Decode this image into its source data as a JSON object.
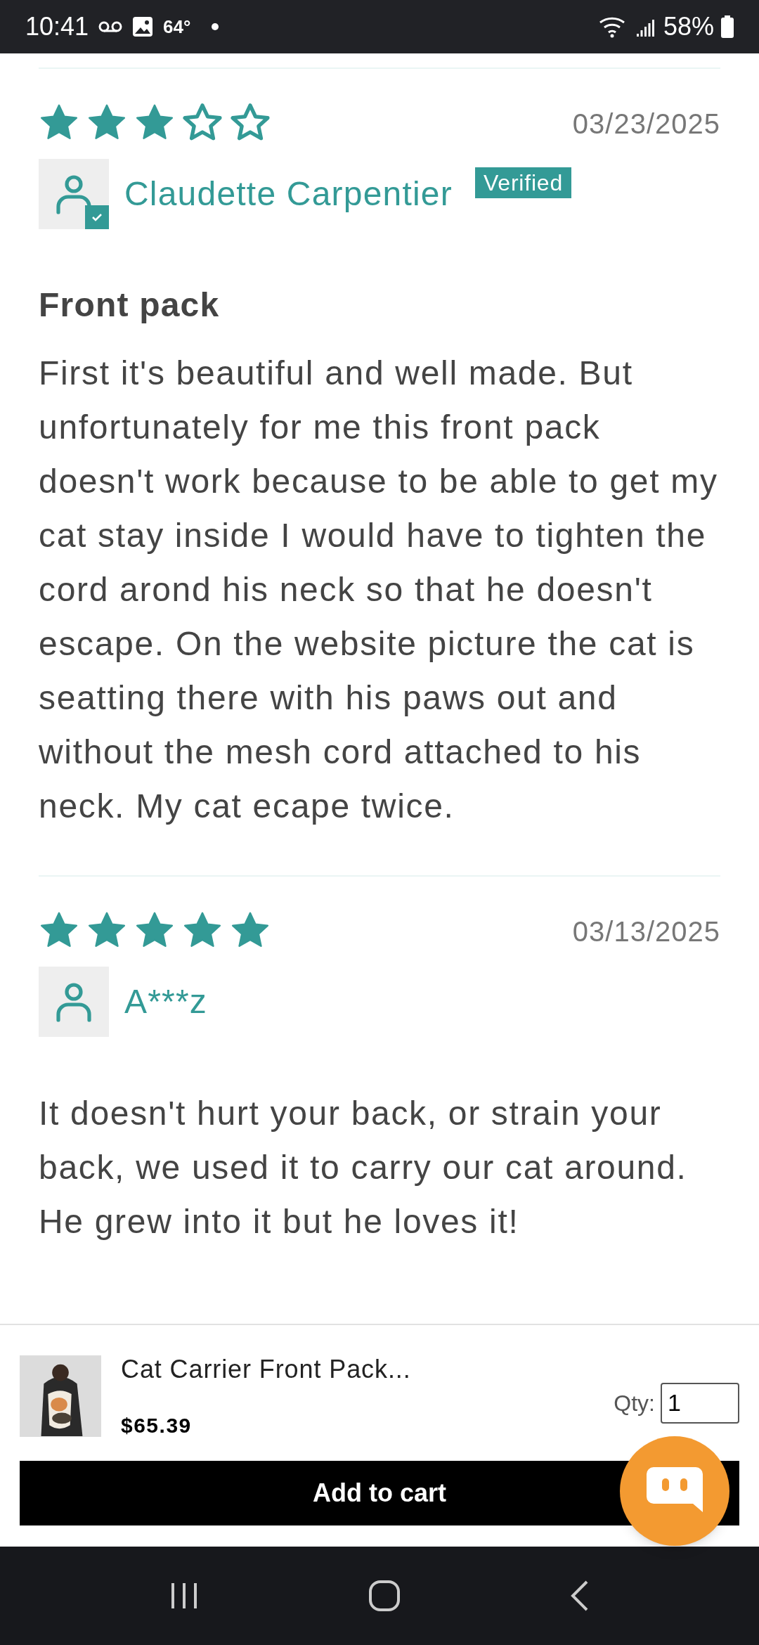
{
  "status_bar": {
    "time": "10:41",
    "temperature": "64°",
    "battery": "58%"
  },
  "reviews": [
    {
      "stars": 3,
      "date": "03/23/2025",
      "reviewer": "Claudette Carpentier",
      "verified": true,
      "badge": "Verified",
      "title": "Front pack",
      "body": "First it's beautiful and well made. But unfortunately for me this front pack doesn't work because to be able to get my cat stay inside I would have to tighten the cord arond his neck so that he doesn't escape. On the website picture the cat is seatting there with his paws out and without the mesh cord attached to his neck. My cat ecape twice."
    },
    {
      "stars": 5,
      "date": "03/13/2025",
      "reviewer": "A***z",
      "verified": false,
      "body": "It doesn't hurt your back, or strain your back, we used it to carry our cat around. He grew into it but he loves it!"
    }
  ],
  "product_bar": {
    "name": "Cat Carrier Front Pack...",
    "price": "$65.39",
    "qty_label": "Qty:",
    "qty_value": "1",
    "button": "Add to cart"
  }
}
